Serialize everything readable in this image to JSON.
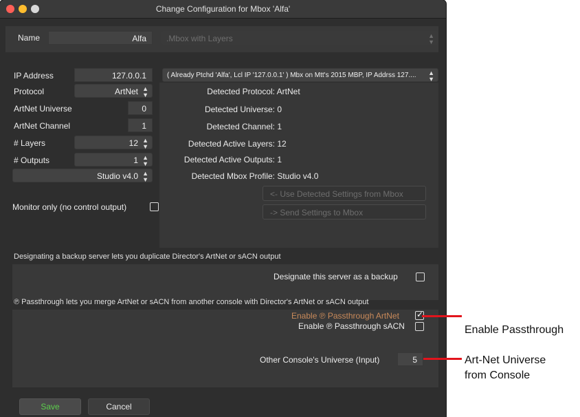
{
  "window": {
    "title": "Change Configuration for Mbox 'Alfa'"
  },
  "name_row": {
    "label": "Name",
    "value": "Alfa",
    "profile_select": ".Mbox with Layers"
  },
  "ip_row": {
    "label": "IP Address",
    "value": "127.0.0.1",
    "server_select": "( Already Ptchd 'Alfa', Lcl IP '127.0.0.1' ) Mbx on Mtt's 2015 MBP, IP Addrss 127...."
  },
  "settings": {
    "protocol": {
      "label": "Protocol",
      "value": "ArtNet"
    },
    "universe": {
      "label": "ArtNet Universe",
      "value": "0"
    },
    "channel": {
      "label": "ArtNet Channel",
      "value": "1"
    },
    "layers": {
      "label": "# Layers",
      "value": "12"
    },
    "outputs": {
      "label": "# Outputs",
      "value": "1"
    },
    "profile": {
      "value": "Studio v4.0"
    }
  },
  "detected": {
    "protocol": {
      "key": "Detected Protocol:",
      "value": "ArtNet"
    },
    "universe": {
      "key": "Detected Universe:",
      "value": "0"
    },
    "channel": {
      "key": "Detected Channel:",
      "value": "1"
    },
    "layers": {
      "key": "Detected Active Layers:",
      "value": "12"
    },
    "outputs": {
      "key": "Detected Active Outputs:",
      "value": "1"
    },
    "profile": {
      "key": "Detected Mbox Profile:",
      "value": "Studio v4.0"
    },
    "use_button": "<- Use Detected Settings from Mbox",
    "send_button": "-> Send Settings to Mbox"
  },
  "monitor": {
    "label": "Monitor only (no control output)",
    "checked": false
  },
  "backup": {
    "description": "Designating a backup server lets you duplicate Director's ArtNet or sACN output",
    "checkbox_label": "Designate this server as a backup",
    "checked": false
  },
  "passthrough": {
    "description": "℗ Passthrough lets you merge ArtNet or sACN from another console with Director's ArtNet or sACN output",
    "artnet_label": "Enable ℗ Passthrough ArtNet",
    "artnet_checked": true,
    "sacn_label": "Enable ℗ Passthrough sACN",
    "sacn_checked": false,
    "universe_label": "Other Console's Universe (Input)",
    "universe_value": "5"
  },
  "footer": {
    "save_label": "Save",
    "cancel_label": "Cancel"
  },
  "annotations": {
    "passthrough": "Enable Passthrough",
    "universe_line1": "Art-Net Universe",
    "universe_line2": "from Console"
  },
  "colors": {
    "save_green": "#5ccf4c",
    "annotation_red": "#e2141c",
    "window_bg": "#2e2e2e"
  }
}
